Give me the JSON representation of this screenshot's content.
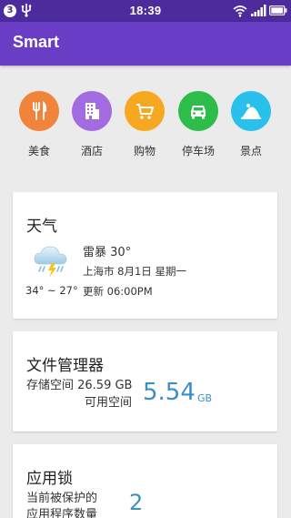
{
  "status_bar": {
    "notification_count": "3",
    "time": "18:39"
  },
  "app_bar": {
    "title": "Smart"
  },
  "categories": [
    {
      "label": "美食",
      "icon": "fork-knife-icon",
      "color": "#f0843a"
    },
    {
      "label": "酒店",
      "icon": "building-icon",
      "color": "#a26be0"
    },
    {
      "label": "购物",
      "icon": "shopping-cart-icon",
      "color": "#f5a820"
    },
    {
      "label": "停车场",
      "icon": "car-icon",
      "color": "#2ebd4a"
    },
    {
      "label": "景点",
      "icon": "landmark-icon",
      "color": "#29c0ec"
    }
  ],
  "weather": {
    "title": "天气",
    "condition": "雷暴 30°",
    "location_date": "上海市 8月1日 星期一",
    "updated": "更新  06:00PM",
    "range": "34° ~ 27°",
    "icon": "thunderstorm-icon"
  },
  "file_manager": {
    "title": "文件管理器",
    "storage_line": "存储空间  26.59 GB",
    "available_label": "可用空间",
    "available_value": "5.54",
    "available_unit": "GB"
  },
  "app_lock": {
    "title": "应用锁",
    "line1": "当前被保护的",
    "line2": "应用程序数量",
    "count": "2"
  }
}
